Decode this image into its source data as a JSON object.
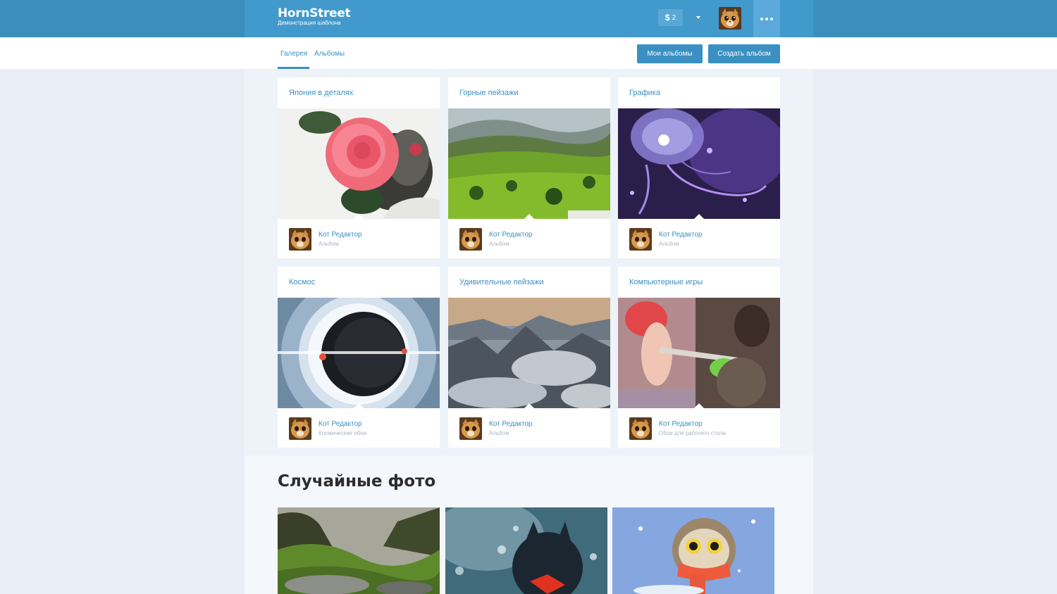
{
  "header": {
    "logo_title": "HornStreet",
    "logo_subtitle": "Демонстрация шаблона",
    "credits_symbol": "$",
    "credits_value": "2"
  },
  "subnav": {
    "tabs": [
      {
        "label": "Галерея"
      },
      {
        "label": "Альбомы"
      }
    ],
    "my_albums_label": "Мои альбомы",
    "create_album_label": "Создать альбом"
  },
  "albums": [
    {
      "title": "Япония в деталях",
      "author": "Кот Редактор",
      "subtitle": "Альбом"
    },
    {
      "title": "Горные пейзажи",
      "author": "Кот Редактор",
      "subtitle": "Альбом"
    },
    {
      "title": "Графика",
      "author": "Кот Редактор",
      "subtitle": "Альбом"
    },
    {
      "title": "Космос",
      "author": "Кот Редактор",
      "subtitle": "Космические обои"
    },
    {
      "title": "Удивительные пейзажи",
      "author": "Кот Редактор",
      "subtitle": "Альбом"
    },
    {
      "title": "Компьютерные игры",
      "author": "Кот Редактор",
      "subtitle": "Обои для рабочего стола"
    }
  ],
  "random": {
    "title": "Случайные фото"
  },
  "colors": {
    "header_bg": "#4199cc",
    "accent": "#3b8fc2",
    "page_bg": "#e9eef6"
  },
  "icons": [
    "dollar-icon",
    "caret-down-icon",
    "more-dots-icon"
  ]
}
